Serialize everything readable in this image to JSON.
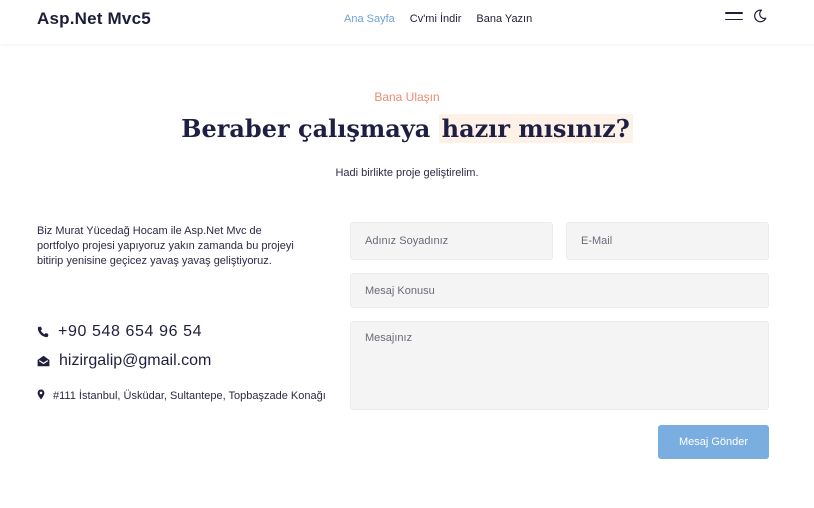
{
  "header": {
    "brand": "Asp.Net Mvc5",
    "nav": [
      {
        "label": "Ana Sayfa",
        "active": true
      },
      {
        "label": "Cv'mi İndir",
        "active": false
      },
      {
        "label": "Bana Yazın",
        "active": false
      }
    ],
    "icons": [
      "menu-icon",
      "moon-icon"
    ]
  },
  "hero": {
    "eyebrow": "Bana Ulaşın",
    "headline_part1": "Beraber çalışmaya ",
    "headline_part2": "hazır mısınız?",
    "subline": "Hadi birlikte proje geliştirelim."
  },
  "contact": {
    "about": "Biz Murat Yücedağ Hocam ile Asp.Net Mvc de portfolyo projesi yapıyoruz yakın zamanda bu projeyi bitirip yenisine geçicez yavaş yavaş geliştiyoruz.",
    "phone": "+90 548 654 96 54",
    "email": "hizirgalip@gmail.com",
    "address": "#111 İstanbul, Üsküdar, Sultantepe, Topbaşzade Konağı"
  },
  "form": {
    "name_placeholder": "Adınız Soyadınız",
    "email_placeholder": "E-Mail",
    "subject_placeholder": "Mesaj Konusu",
    "message_placeholder": "Mesajınız",
    "submit_label": "Mesaj Gönder"
  },
  "colors": {
    "accent": "#7aaee0",
    "eyebrow": "#ec8a73",
    "highlight": "#fdf1e8",
    "nav_active": "#6fa2d8"
  }
}
